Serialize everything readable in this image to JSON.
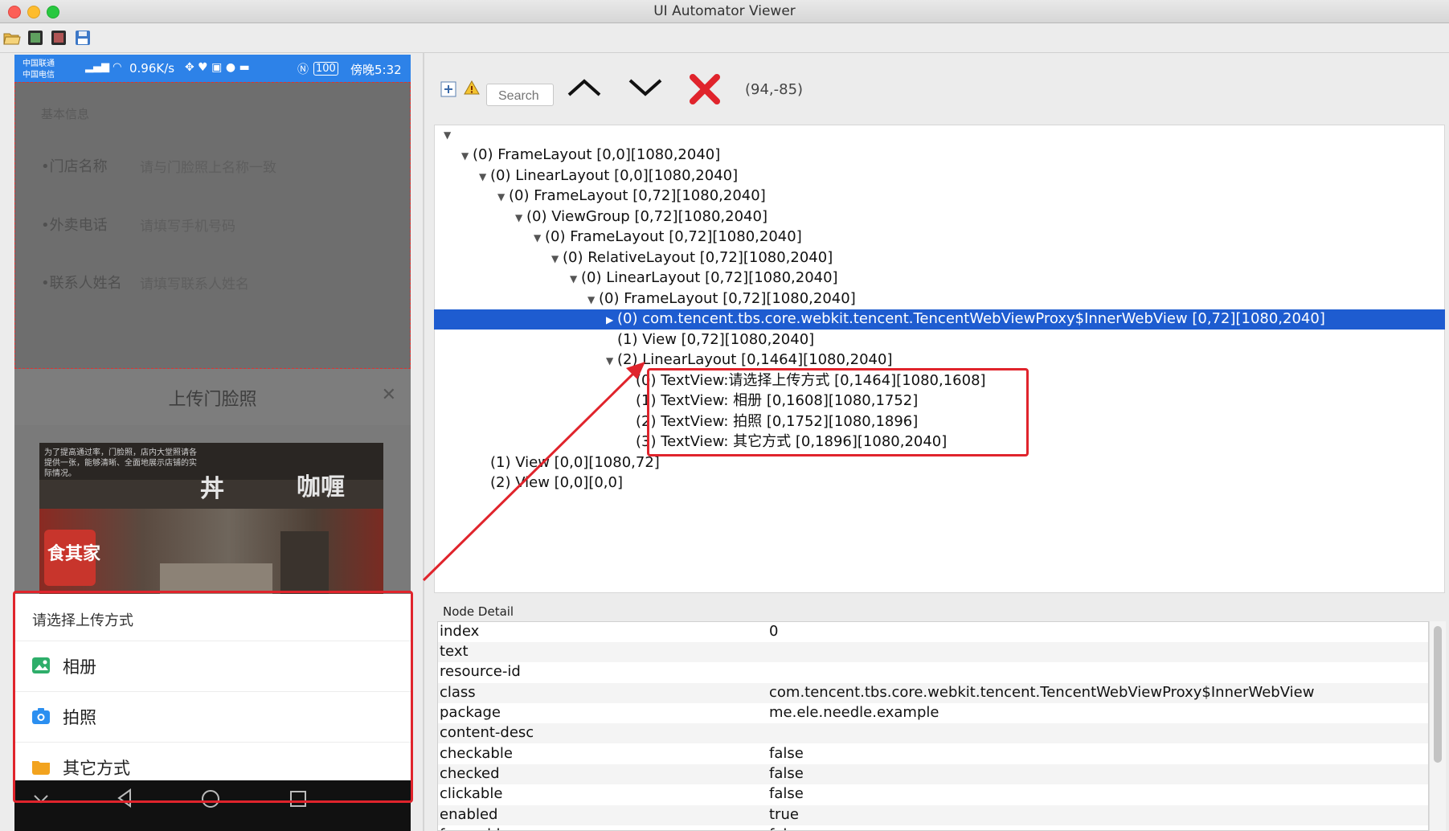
{
  "window": {
    "title": "UI Automator Viewer"
  },
  "toolbar": {
    "icons": [
      "open-folder-icon",
      "device-screenshot-icon",
      "device-screenshot-compressed-icon",
      "save-icon"
    ]
  },
  "device": {
    "statusbar": {
      "carrier_top": "中国联通",
      "carrier_bottom": "中国电信",
      "speed": "0.96K/s",
      "battery": "100",
      "time": "傍晚5:32"
    },
    "form": {
      "section_title": "基本信息",
      "fields": [
        {
          "label": "•门店名称",
          "placeholder": "请与门脸照上名称一致"
        },
        {
          "label": "•外卖电话",
          "placeholder": "请填写手机号码"
        },
        {
          "label": "•联系人姓名",
          "placeholder": "请填写联系人姓名"
        }
      ]
    },
    "upload": {
      "title": "上传门脸照",
      "close": "✕",
      "hint": "为了提高通过率，门脸照，店内大堂照请各提供一张，能够清晰、全面地展示店铺的实际情况。",
      "shop_sign_left": "丼",
      "shop_sign_right": "咖喱",
      "shop_logo": "食其家"
    },
    "sheet": {
      "title": "请选择上传方式",
      "options": [
        {
          "label": "相册",
          "icon": "album-icon",
          "color": "#2eae6a"
        },
        {
          "label": "拍照",
          "icon": "camera-icon",
          "color": "#2b8ff0"
        },
        {
          "label": "其它方式",
          "icon": "folder-icon",
          "color": "#f2a31e"
        }
      ]
    },
    "navbar": {
      "buttons": [
        "hide-keyboard-icon",
        "back-icon",
        "home-icon",
        "recents-icon"
      ]
    }
  },
  "tree_toolbar": {
    "search_placeholder": "Search",
    "coords": "(94,-85)"
  },
  "tree": {
    "nodes": [
      {
        "text": "(0) FrameLayout [0,0][1080,2040]",
        "toggle": "▼"
      },
      {
        "text": "(0) LinearLayout [0,0][1080,2040]",
        "toggle": "▼"
      },
      {
        "text": "(0) FrameLayout [0,72][1080,2040]",
        "toggle": "▼"
      },
      {
        "text": "(0) ViewGroup [0,72][1080,2040]",
        "toggle": "▼"
      },
      {
        "text": "(0) FrameLayout [0,72][1080,2040]",
        "toggle": "▼"
      },
      {
        "text": "(0) RelativeLayout [0,72][1080,2040]",
        "toggle": "▼"
      },
      {
        "text": "(0) LinearLayout [0,72][1080,2040]",
        "toggle": "▼"
      },
      {
        "text": "(0) FrameLayout [0,72][1080,2040]",
        "toggle": "▼"
      },
      {
        "text": "(0) com.tencent.tbs.core.webkit.tencent.TencentWebViewProxy$InnerWebView [0,72][1080,2040]",
        "toggle": "▶",
        "selected": true
      },
      {
        "text": "(1) View [0,72][1080,2040]",
        "toggle": ""
      },
      {
        "text": "(2) LinearLayout [0,1464][1080,2040]",
        "toggle": "▼"
      },
      {
        "text": "(0) TextView:请选择上传方式 [0,1464][1080,1608]",
        "toggle": ""
      },
      {
        "text": "(1) TextView:  相册 [0,1608][1080,1752]",
        "toggle": ""
      },
      {
        "text": "(2) TextView:  拍照 [0,1752][1080,1896]",
        "toggle": ""
      },
      {
        "text": "(3) TextView:  其它方式 [0,1896][1080,2040]",
        "toggle": ""
      },
      {
        "text": "(1) View [0,0][1080,72]",
        "toggle": ""
      },
      {
        "text": "(2) View [0,0][0,0]",
        "toggle": ""
      }
    ]
  },
  "detail": {
    "title": "Node Detail",
    "rows": [
      {
        "key": "index",
        "value": "0"
      },
      {
        "key": "text",
        "value": ""
      },
      {
        "key": "resource-id",
        "value": ""
      },
      {
        "key": "class",
        "value": "com.tencent.tbs.core.webkit.tencent.TencentWebViewProxy$InnerWebView"
      },
      {
        "key": "package",
        "value": "me.ele.needle.example"
      },
      {
        "key": "content-desc",
        "value": ""
      },
      {
        "key": "checkable",
        "value": "false"
      },
      {
        "key": "checked",
        "value": "false"
      },
      {
        "key": "clickable",
        "value": "false"
      },
      {
        "key": "enabled",
        "value": "true"
      },
      {
        "key": "focusable",
        "value": "false"
      }
    ]
  },
  "colors": {
    "accent": "#1e5cd0",
    "annotation": "#e0242c",
    "statusbar": "#2d82e8"
  }
}
